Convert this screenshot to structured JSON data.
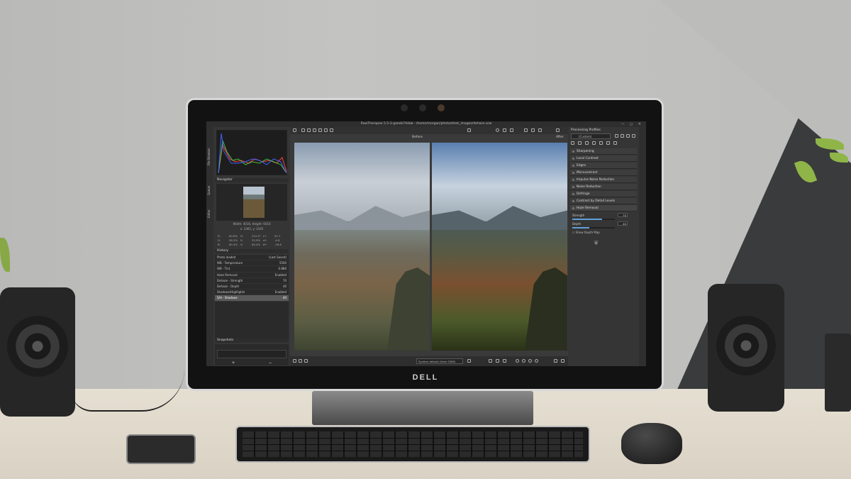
{
  "window": {
    "title": "RawTherapee 5.5-3-gaeeb74dab - /home/morgan/photos/test_images/dehaze.arw",
    "controls": "— ◻ ✕"
  },
  "monitor_brand": "DELL",
  "left_tabs": [
    "File Browser",
    "Queue",
    "Editor"
  ],
  "navigator": {
    "title": "Navigator",
    "size_text": "Width: 4016, Height: 6016",
    "coords_text": "x: 2365, y: 3345",
    "values": [
      "R:",
      "60.8%",
      "H:",
      "210.5°",
      "L*:",
      "52.7",
      "G:",
      "58.3%",
      "S:",
      "32.9%",
      "a*:",
      "-4.6",
      "B:",
      "60.4%",
      "V:",
      "60.4%",
      "b*:",
      "-16.6"
    ]
  },
  "history": {
    "title": "History",
    "rows": [
      {
        "label": "Photo loaded",
        "value": "(Last Saved)"
      },
      {
        "label": "WB - Temperature",
        "value": "5500"
      },
      {
        "label": "WB - Tint",
        "value": "0.880"
      },
      {
        "label": "Haze Removal",
        "value": "Enabled"
      },
      {
        "label": "Dehaze - Strength",
        "value": "70"
      },
      {
        "label": "Dehaze - Depth",
        "value": "40"
      },
      {
        "label": "Shadows/Highlights",
        "value": "Enabled"
      },
      {
        "label": "S/H - Shadows",
        "value": "40"
      }
    ],
    "selected_index": 7
  },
  "snapshots": {
    "title": "Snapshots",
    "add": "+",
    "remove": "−"
  },
  "preview": {
    "before_label": "Before",
    "after_label": "After",
    "profile": "System default (from ODM)"
  },
  "right_panel": {
    "title": "Processing Profiles",
    "profile_value": "(Custom)",
    "tools": [
      "Sharpening",
      "Local Contrast",
      "Edges",
      "Microcontrast",
      "Impulse Noise Reduction",
      "Noise Reduction",
      "Defringe",
      "Contrast by Detail Levels",
      "Haze Removal"
    ],
    "haze": {
      "strength_label": "Strength",
      "strength_value": "70",
      "strength_pct": 0.7,
      "depth_label": "Depth",
      "depth_value": "40",
      "depth_pct": 0.4,
      "depth_map_label": "Show Depth Map"
    }
  },
  "colors": {
    "accent": "#5fa0d8",
    "panel": "#353535",
    "selected_row": "#5a5a5a"
  }
}
